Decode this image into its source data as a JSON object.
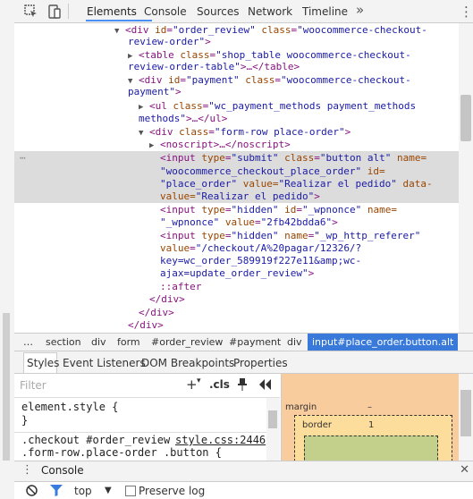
{
  "toolbar": {
    "tabs": [
      "Elements",
      "Console",
      "Sources",
      "Network",
      "Timeline"
    ],
    "more": "»",
    "menu": "⋮"
  },
  "dom": {
    "l1": {
      "attr1": "id",
      "val1": "\"order_review\"",
      "attr2": "class",
      "val2": "\"woocommerce-checkout-"
    },
    "l1b": "review-order\"",
    "l2": {
      "attr1": "class",
      "val1": "\"shop_table woocommerce-checkout-"
    },
    "l2b": "review-order-table\"",
    "l2c": "…</table>",
    "l3": {
      "attr1": "id",
      "val1": "\"payment\"",
      "attr2": "class",
      "val2": "\"woocommerce-checkout-"
    },
    "l3b": "payment\"",
    "l4": {
      "attr1": "class",
      "val1": "\"wc_payment_methods payment_methods"
    },
    "l4b": "methods\"",
    "l4c": "…</ul>",
    "l5": {
      "attr1": "class",
      "val1": "\"form-row place-order\""
    },
    "l6": "<noscript>…</noscript>",
    "sel1": {
      "attr1": "type",
      "val1": "\"submit\"",
      "attr2": "class",
      "val2": "\"button alt\"",
      "attr3": "name="
    },
    "sel2": {
      "val": "\"woocommerce_checkout_place_order\"",
      "attr": "id="
    },
    "sel3": {
      "val": "\"place_order\"",
      "attr": "value=",
      "val2": "\"Realizar el pedido\"",
      "attr2": "data-"
    },
    "sel4": {
      "attr": "value=",
      "val": "\"Realizar el pedido\""
    },
    "h1": {
      "attr1": "type",
      "val1": "\"hidden\"",
      "attr2": "id",
      "val2": "\"_wpnonce\"",
      "attr3": "name="
    },
    "h1b": {
      "val": "\"_wpnonce\"",
      "attr": "value",
      "val2": "\"2fb42bdda6\""
    },
    "h2": {
      "attr1": "type",
      "val1": "\"hidden\"",
      "attr2": "name",
      "val2": "\"_wp_http_referer\""
    },
    "h2b": {
      "attr": "value",
      "val": "\"/checkout/A%20pagar/12326/?"
    },
    "h2c": "key=wc_order_589919f227e11&amp;wc-",
    "h2d": "ajax=update_order_review\"",
    "after": "::after",
    "close1": "</div>",
    "close2": "</div>",
    "close3": "</div>"
  },
  "breadcrumbs": [
    "…",
    "section",
    "div",
    "form",
    "#order_review",
    "#payment",
    "div"
  ],
  "breadcrumb_selected": "input#place_order.button.alt",
  "styles_tabs": [
    "Styles",
    "Event Listeners",
    "DOM Breakpoints",
    "Properties"
  ],
  "filter": {
    "placeholder": "Filter",
    "plus": "+",
    "cls": ".cls"
  },
  "rules": {
    "element_style": "element.style {",
    "element_close": "}",
    "rule2_selector": ".checkout #order_review",
    "rule2_source": "style.css:2446",
    "rule2_line2": ".form-row.place-order .button {"
  },
  "boxmodel": {
    "margin": "margin",
    "margin_val": "–",
    "border": "border",
    "border_val": "1"
  },
  "console": {
    "tab": "Console",
    "context": "top",
    "preserve_log": "Preserve log"
  },
  "colors": {
    "accent": "#4b8ff4",
    "crumb_selected": "#3879d9",
    "margin": "#f9cc9d",
    "border": "#fddd9b",
    "padding": "#c3d08b"
  }
}
